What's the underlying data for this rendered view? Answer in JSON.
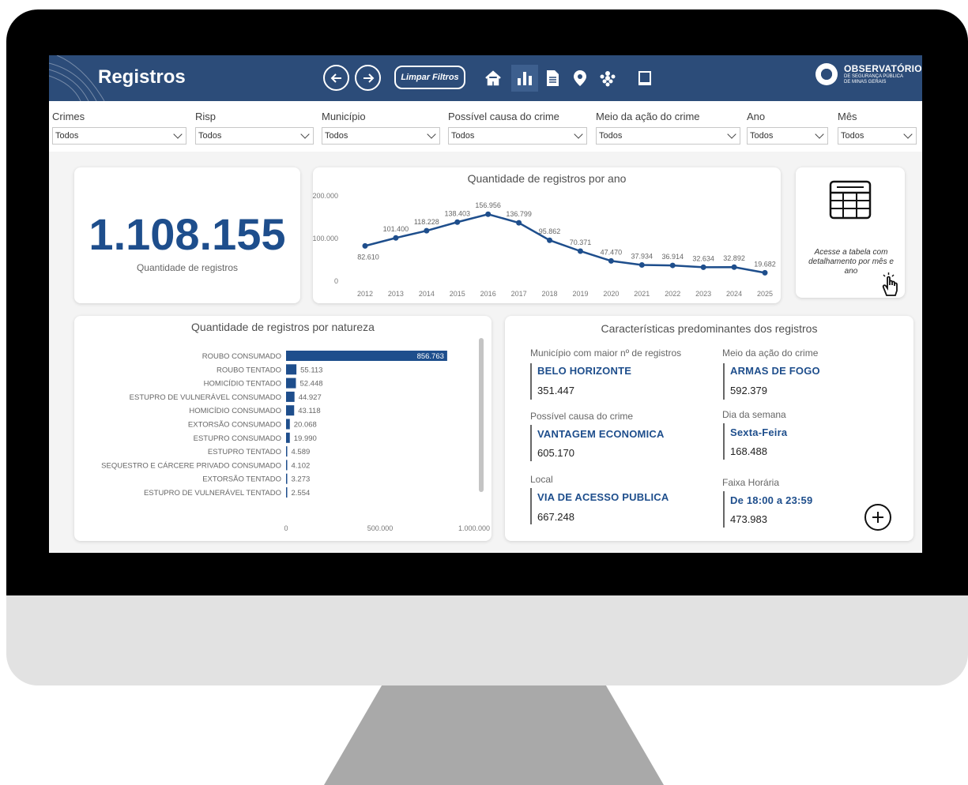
{
  "header": {
    "title": "Registros",
    "clear_filters_label": "Limpar Filtros",
    "brand_name": "OBSERVATÓRIO",
    "brand_sub_1": "DE SEGURANÇA PÚBLICA",
    "brand_sub_2": "DE MINAS GERAIS",
    "bg_color": "#2c4c79",
    "icons": [
      "arrow-left-icon",
      "arrow-right-icon",
      "home-icon",
      "bar-chart-icon",
      "document-icon",
      "map-pin-icon",
      "people-icon",
      "book-icon"
    ]
  },
  "filters": [
    {
      "label": "Crimes",
      "value": "Todos"
    },
    {
      "label": "Risp",
      "value": "Todos"
    },
    {
      "label": "Município",
      "value": "Todos"
    },
    {
      "label": "Possível causa do crime",
      "value": "Todos"
    },
    {
      "label": "Meio da ação do crime",
      "value": "Todos"
    },
    {
      "label": "Ano",
      "value": "Todos"
    },
    {
      "label": "Mês",
      "value": "Todos"
    }
  ],
  "kpi": {
    "value": "1.108.155",
    "label": "Quantidade de registros"
  },
  "detail_card": {
    "text": "Acesse a tabela com detalhamento por mês e ano"
  },
  "characteristics": {
    "title": "Características predominantes dos registros",
    "items": [
      {
        "label": "Município com maior nº de registros",
        "value": "BELO HORIZONTE",
        "count": "351.447"
      },
      {
        "label": "Meio da ação do crime",
        "value": "ARMAS DE FOGO",
        "count": "592.379"
      },
      {
        "label": "Possível causa do crime",
        "value": "VANTAGEM ECONOMICA",
        "count": "605.170"
      },
      {
        "label": "Dia da semana",
        "value": "Sexta-Feira",
        "count": "168.488"
      },
      {
        "label": "Local",
        "value": "VIA DE ACESSO PUBLICA",
        "count": "667.248"
      },
      {
        "label": "Faixa Horária",
        "value": "De 18:00 a 23:59",
        "count": "473.983"
      }
    ]
  },
  "chart_data": [
    {
      "type": "line",
      "title": "Quantidade de registros por ano",
      "x": [
        "2012",
        "2013",
        "2014",
        "2015",
        "2016",
        "2017",
        "2018",
        "2019",
        "2020",
        "2021",
        "2022",
        "2023",
        "2024",
        "2025"
      ],
      "values": [
        82610,
        101400,
        118228,
        138403,
        156956,
        136799,
        95862,
        70371,
        47470,
        37934,
        36914,
        32634,
        32892,
        19682
      ],
      "labels": [
        "82.610",
        "101.400",
        "118.228",
        "138.403",
        "156.956",
        "136.799",
        "95.862",
        "70.371",
        "47.470",
        "37.934",
        "36.914",
        "32.634",
        "32.892",
        "19.682"
      ],
      "yticks": [
        "0",
        "100.000",
        "200.000"
      ],
      "ylim": [
        0,
        200000
      ],
      "color": "#1e4e8c"
    },
    {
      "type": "bar",
      "orientation": "horizontal",
      "title": "Quantidade de registros por natureza",
      "categories": [
        "ROUBO CONSUMADO",
        "ROUBO TENTADO",
        "HOMICÍDIO TENTADO",
        "ESTUPRO DE VULNERÁVEL CONSUMADO",
        "HOMICÍDIO CONSUMADO",
        "EXTORSÃO CONSUMADO",
        "ESTUPRO CONSUMADO",
        "ESTUPRO TENTADO",
        "SEQUESTRO E CÁRCERE PRIVADO CONSUMADO",
        "EXTORSÃO TENTADO",
        "ESTUPRO DE VULNERÁVEL TENTADO"
      ],
      "values": [
        856763,
        55113,
        52448,
        44927,
        43118,
        20068,
        19990,
        4589,
        4102,
        3273,
        2554
      ],
      "labels": [
        "856.763",
        "55.113",
        "52.448",
        "44.927",
        "43.118",
        "20.068",
        "19.990",
        "4.589",
        "4.102",
        "3.273",
        "2.554"
      ],
      "xticks": [
        "0",
        "500.000",
        "1.000.000"
      ],
      "xlim": [
        0,
        1000000
      ],
      "color": "#1e4e8c"
    }
  ]
}
